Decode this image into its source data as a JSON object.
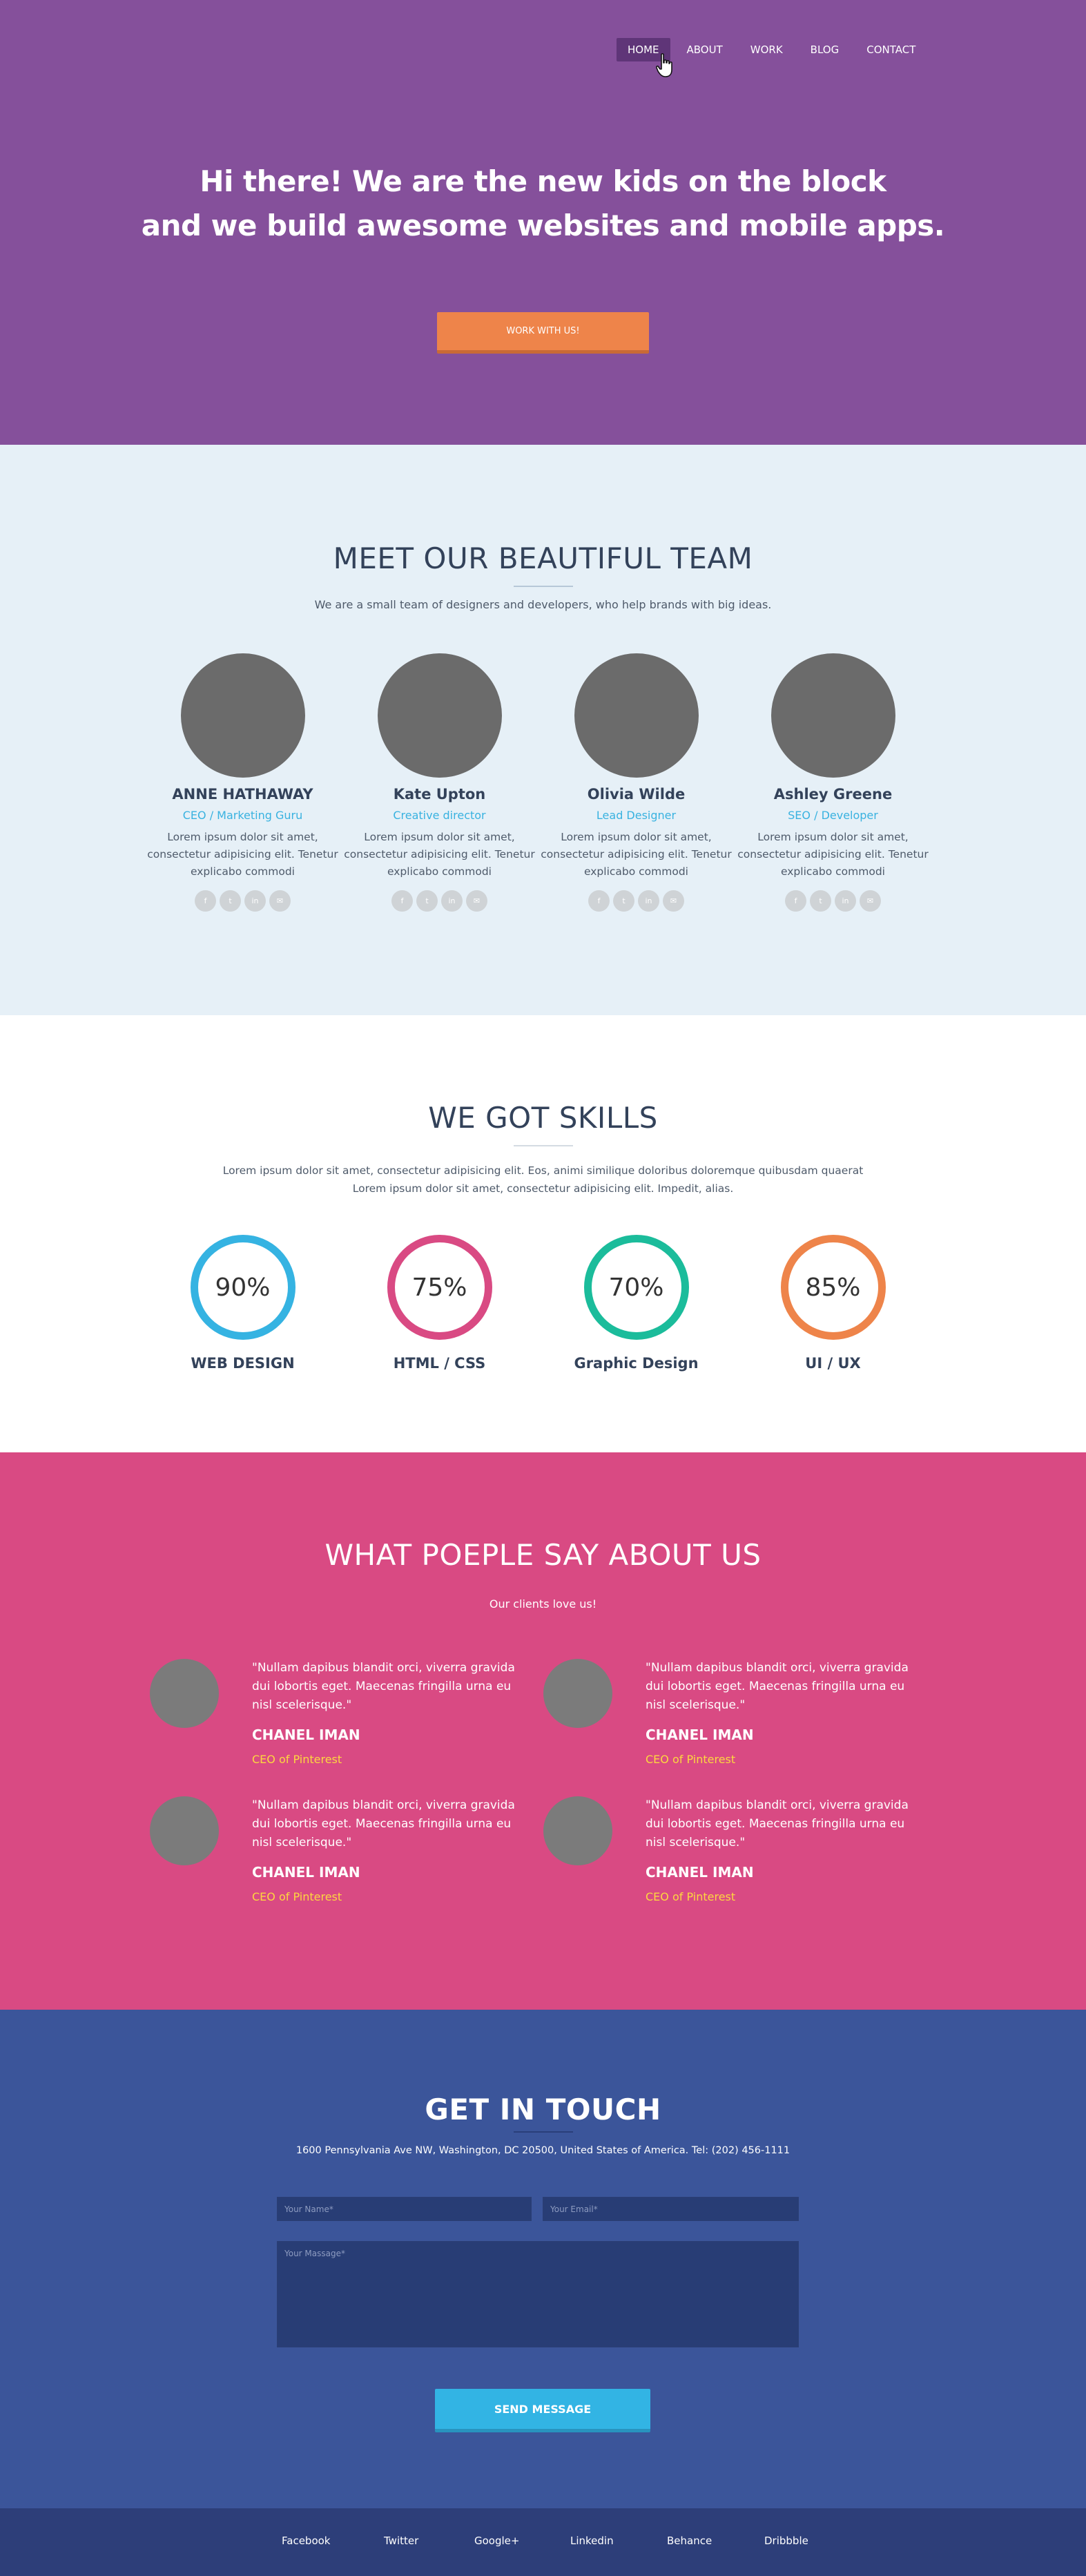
{
  "nav": {
    "items": [
      {
        "label": "HOME",
        "active": true
      },
      {
        "label": "ABOUT"
      },
      {
        "label": "WORK"
      },
      {
        "label": "BLOG"
      },
      {
        "label": "CONTACT"
      }
    ]
  },
  "hero": {
    "line1": "Hi there! We are the new kids on the block",
    "line2": "and we build awesome websites and mobile apps.",
    "cta_label": "WORK WITH US!"
  },
  "team": {
    "title": "MEET OUR BEAUTIFUL TEAM",
    "subtitle": "We are a small team of designers and developers, who help brands with big ideas.",
    "members": [
      {
        "name": "ANNE HATHAWAY",
        "role": "CEO / Marketing Guru",
        "bio": "Lorem ipsum dolor sit amet, consectetur adipisicing elit. Tenetur explicabo commodi"
      },
      {
        "name": "Kate Upton",
        "role": "Creative director",
        "bio": "Lorem ipsum dolor sit amet, consectetur adipisicing elit. Tenetur explicabo commodi"
      },
      {
        "name": "Olivia Wilde",
        "role": "Lead Designer",
        "bio": "Lorem ipsum dolor sit amet, consectetur adipisicing elit. Tenetur explicabo commodi"
      },
      {
        "name": "Ashley Greene",
        "role": "SEO / Developer",
        "bio": "Lorem ipsum dolor sit amet, consectetur adipisicing elit. Tenetur explicabo commodi"
      }
    ],
    "social_icons": [
      "facebook-icon",
      "twitter-icon",
      "linkedin-icon",
      "email-icon"
    ],
    "social_glyphs": [
      "f",
      "t",
      "in",
      "✉"
    ]
  },
  "skills": {
    "title": "WE GOT SKILLS",
    "subtitle_line1": "Lorem ipsum dolor sit amet, consectetur adipisicing elit. Eos, animi similique doloribus doloremque quibusdam quaerat",
    "subtitle_line2": "Lorem ipsum dolor sit amet, consectetur adipisicing elit. Impedit, alias.",
    "items": [
      {
        "label": "WEB DESIGN",
        "percent": "90%",
        "color": "#35b3e2"
      },
      {
        "label": "HTML / CSS",
        "percent": "75%",
        "color": "#d94a83"
      },
      {
        "label": "Graphic Design",
        "percent": "70%",
        "color": "#1bbc9b"
      },
      {
        "label": "UI / UX",
        "percent": "85%",
        "color": "#ee844a"
      }
    ]
  },
  "testimonials": {
    "title": "WHAT POEPLE SAY ABOUT US",
    "subtitle": "Our clients love us!",
    "items": [
      {
        "quote": "\"Nullam dapibus blandit orci, viverra gravida dui lobortis eget. Maecenas fringilla urna eu nisl scelerisque.\"",
        "name": "CHANEL IMAN",
        "role": "CEO of Pinterest"
      },
      {
        "quote": "\"Nullam dapibus blandit orci, viverra gravida dui lobortis eget. Maecenas fringilla urna eu nisl scelerisque.\"",
        "name": "CHANEL IMAN",
        "role": "CEO of Pinterest"
      },
      {
        "quote": "\"Nullam dapibus blandit orci, viverra gravida dui lobortis eget. Maecenas fringilla urna eu nisl scelerisque.\"",
        "name": "CHANEL IMAN",
        "role": "CEO of Pinterest"
      },
      {
        "quote": "\"Nullam dapibus blandit orci, viverra gravida dui lobortis eget. Maecenas fringilla urna eu nisl scelerisque.\"",
        "name": "CHANEL IMAN",
        "role": "CEO of Pinterest"
      }
    ]
  },
  "contact": {
    "title": "GET IN TOUCH",
    "address": "1600 Pennsylvania Ave NW, Washington, DC 20500, United States of America. Tel: (202) 456-1111",
    "name_placeholder": "Your Name*",
    "email_placeholder": "Your Email*",
    "message_placeholder": "Your Massage*",
    "send_label": "SEND MESSAGE"
  },
  "footer": {
    "links": [
      "Facebook",
      "Twitter",
      "Google+",
      "Linkedin",
      "Behance",
      "Dribbble"
    ]
  },
  "colors": {
    "hero_bg": "#85509b",
    "team_bg": "#e6f0f7",
    "testimonials_bg": "#d94a83",
    "contact_bg": "#3b559a",
    "footer_bg": "#2d3e79",
    "accent_orange": "#ee844a",
    "accent_blue": "#35b3e2",
    "accent_yellow": "#fdd73f"
  }
}
